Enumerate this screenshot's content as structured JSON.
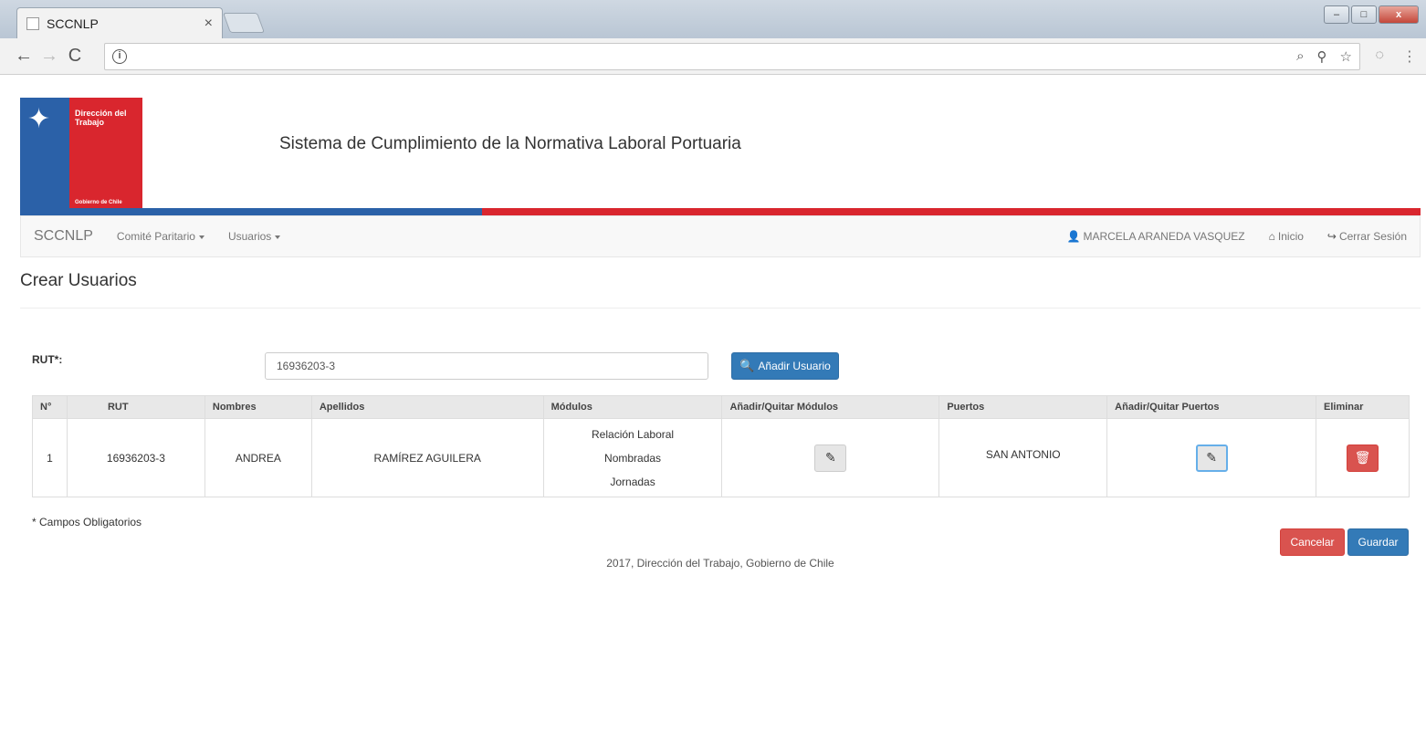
{
  "browser": {
    "tab_title": "SCCNLP",
    "tab_close": "×",
    "win_min": "–",
    "win_max": "□",
    "win_close": "x",
    "back": "←",
    "forward": "→",
    "reload": "C",
    "info": "i",
    "zoom": "⌕",
    "key": "⚲",
    "star": "☆",
    "menu": "⋮",
    "icons": {
      "back": "arrow-left-icon",
      "forward": "arrow-right-icon",
      "reload": "reload-icon",
      "info": "info-icon",
      "zoom": "zoom-icon",
      "key": "key-icon",
      "star": "star-icon",
      "menu": "menu-icon"
    }
  },
  "header": {
    "agency": "Dirección del Trabajo",
    "gov": "Gobierno de Chile",
    "system_title": "Sistema de Cumplimiento de la Normativa Laboral Portuaria",
    "colors": {
      "blue": "#2b61a8",
      "red": "#d9262e"
    }
  },
  "navbar": {
    "brand": "SCCNLP",
    "items": [
      {
        "label": "Comité Paritario"
      },
      {
        "label": "Usuarios"
      }
    ],
    "user": "MARCELA ARANEDA VASQUEZ",
    "home": "Inicio",
    "logout": "Cerrar Sesión"
  },
  "page": {
    "title": "Crear Usuarios",
    "rut_label": "RUT*:",
    "rut_value": "16936203-3",
    "add_button": "Añadir Usuario",
    "required_note": "* Campos Obligatorios",
    "cancel": "Cancelar",
    "save": "Guardar",
    "footer": "2017, Dirección del Trabajo, Gobierno de Chile"
  },
  "table": {
    "headers": [
      "N°",
      "RUT",
      "Nombres",
      "Apellidos",
      "Módulos",
      "Añadir/Quitar Módulos",
      "Puertos",
      "Añadir/Quitar Puertos",
      "Eliminar"
    ],
    "rows": [
      {
        "num": "1",
        "rut": "16936203-3",
        "nombres": "ANDREA",
        "apellidos": "RAMÍREZ AGUILERA",
        "modulos": [
          "Relación Laboral",
          "Nombradas",
          "Jornadas"
        ],
        "puertos": "SAN ANTONIO"
      }
    ]
  }
}
